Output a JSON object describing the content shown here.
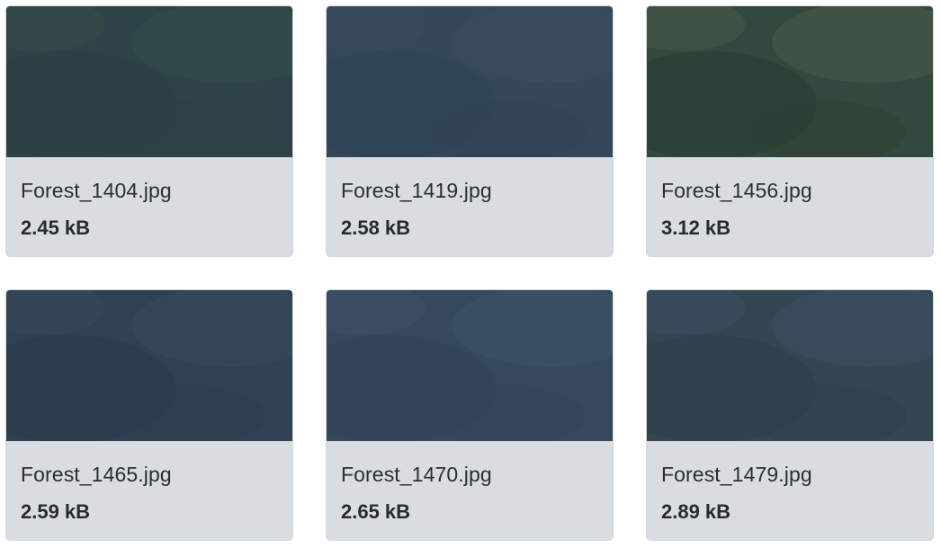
{
  "files": [
    {
      "name": "Forest_1404.jpg",
      "size": "2.45 kB",
      "thumb": {
        "base": "#2e4347",
        "tint": "#2c3f45",
        "accent": "#36504a"
      }
    },
    {
      "name": "Forest_1419.jpg",
      "size": "2.58 kB",
      "thumb": {
        "base": "#34485a",
        "tint": "#2f4453",
        "accent": "#3b5060"
      }
    },
    {
      "name": "Forest_1456.jpg",
      "size": "3.12 kB",
      "thumb": {
        "base": "#34493d",
        "tint": "#2b4034",
        "accent": "#4c5f53"
      }
    },
    {
      "name": "Forest_1465.jpg",
      "size": "2.59 kB",
      "thumb": {
        "base": "#2f4253",
        "tint": "#2b3d4d",
        "accent": "#3a4d5c"
      }
    },
    {
      "name": "Forest_1470.jpg",
      "size": "2.65 kB",
      "thumb": {
        "base": "#36495c",
        "tint": "#314458",
        "accent": "#41546a"
      }
    },
    {
      "name": "Forest_1479.jpg",
      "size": "2.89 kB",
      "thumb": {
        "base": "#334652",
        "tint": "#2e3f4b",
        "accent": "#3e5260"
      }
    }
  ],
  "colors": {
    "card_background": "#d9dde2",
    "card_border": "#d4d8dd",
    "filename_text": "#2a2f36",
    "filesize_text": "#262b31"
  }
}
